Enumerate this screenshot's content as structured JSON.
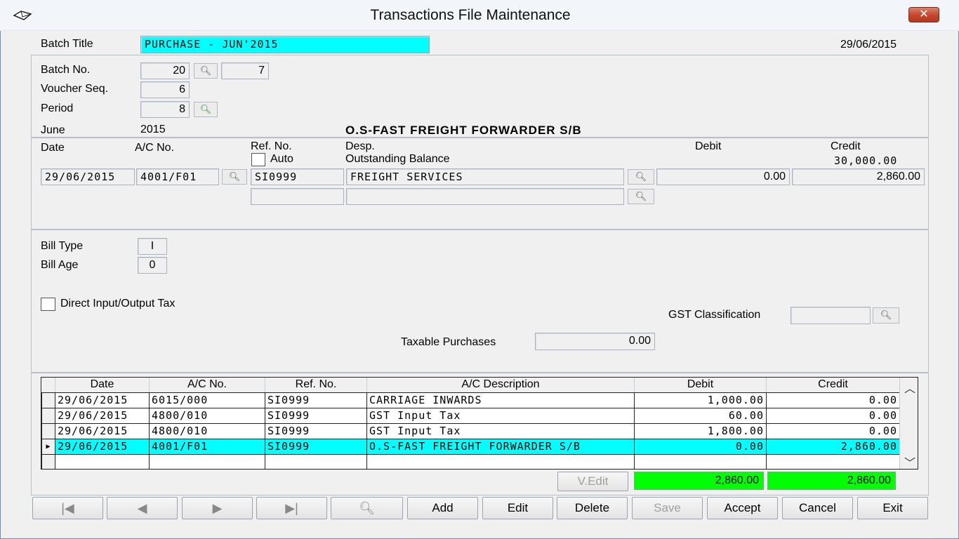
{
  "window": {
    "title": "Transactions File Maintenance",
    "close_label": "✕"
  },
  "header": {
    "batch_title_label": "Batch Title",
    "batch_title_value": "PURCHASE - JUN'2015",
    "date": "29/06/2015"
  },
  "batch": {
    "batch_no_label": "Batch No.",
    "batch_no_value": "20",
    "batch_no_value2": "7",
    "voucher_seq_label": "Voucher Seq.",
    "voucher_seq_value": "6",
    "period_label": "Period",
    "period_value": "8",
    "month": "June",
    "year": "2015",
    "account_name": "O.S-FAST FREIGHT FORWARDER S/B"
  },
  "entry": {
    "date_label": "Date",
    "ac_no_label": "A/C No.",
    "ref_no_label": "Ref. No.",
    "auto_label": "Auto",
    "desp_label": "Desp.",
    "outstanding_label": "Outstanding Balance",
    "debit_label": "Debit",
    "credit_label": "Credit",
    "outstanding_value": "30,000.00",
    "date_value": "29/06/2015",
    "ac_no_value": "4001/F01",
    "ref_no_value": "SI0999",
    "desp_value": "FREIGHT SERVICES",
    "debit_value": "0.00",
    "credit_value": "2,860.00"
  },
  "bill": {
    "bill_type_label": "Bill Type",
    "bill_type_value": "I",
    "bill_age_label": "Bill Age",
    "bill_age_value": "0",
    "direct_tax_label": "Direct Input/Output Tax",
    "gst_label": "GST Classification",
    "taxable_label": "Taxable Purchases",
    "taxable_value": "0.00"
  },
  "grid": {
    "columns": [
      "Date",
      "A/C No.",
      "Ref. No.",
      "A/C Description",
      "Debit",
      "Credit"
    ],
    "rows": [
      {
        "date": "29/06/2015",
        "ac": "6015/000",
        "ref": "SI0999",
        "desc": "CARRIAGE INWARDS",
        "debit": "1,000.00",
        "credit": "0.00"
      },
      {
        "date": "29/06/2015",
        "ac": "4800/010",
        "ref": "SI0999",
        "desc": "GST Input Tax",
        "debit": "60.00",
        "credit": "0.00"
      },
      {
        "date": "29/06/2015",
        "ac": "4800/010",
        "ref": "SI0999",
        "desc": "GST Input Tax",
        "debit": "1,800.00",
        "credit": "0.00"
      },
      {
        "date": "29/06/2015",
        "ac": "4001/F01",
        "ref": "SI0999",
        "desc": "O.S-FAST FREIGHT FORWARDER S/B",
        "debit": "0.00",
        "credit": "2,860.00"
      }
    ],
    "vedit_label": "V.Edit",
    "total_debit": "2,860.00",
    "total_credit": "2,860.00"
  },
  "toolbar": {
    "add": "Add",
    "edit": "Edit",
    "delete": "Delete",
    "save": "Save",
    "accept": "Accept",
    "cancel": "Cancel",
    "exit": "Exit"
  }
}
